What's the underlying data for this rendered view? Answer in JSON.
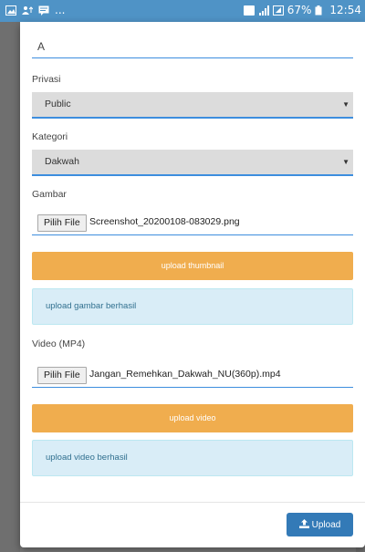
{
  "statusbar": {
    "left_text": "...",
    "battery_text": "67%",
    "time": "12:54"
  },
  "form": {
    "title_value": "A",
    "privacy": {
      "label": "Privasi",
      "selected": "Public"
    },
    "category": {
      "label": "Kategori",
      "selected": "Dakwah"
    },
    "image": {
      "label": "Gambar",
      "choose_label": "Pilih File",
      "file_name": "Screenshot_20200108-083029.png",
      "upload_button": "upload thumbnail",
      "status": "upload gambar berhasil"
    },
    "video": {
      "label": "Video (MP4)",
      "choose_label": "Pilih File",
      "file_name": "Jangan_Remehkan_Dakwah_NU(360p).mp4",
      "upload_button": "upload video",
      "status": "upload video berhasil"
    }
  },
  "footer": {
    "upload_label": "Upload"
  },
  "colors": {
    "statusbar": "#4f93c6",
    "primary": "#337ab7",
    "warning": "#f0ad4e",
    "info_bg": "#d9edf7",
    "info_text": "#31708f",
    "focus_border": "#3d8ede"
  }
}
